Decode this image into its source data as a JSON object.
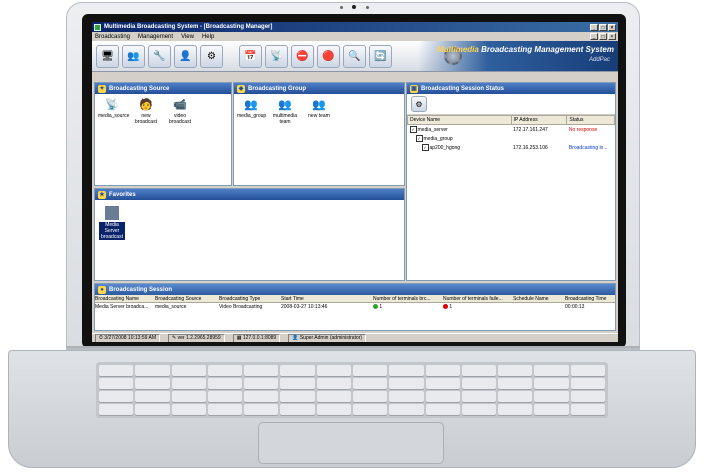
{
  "window": {
    "title": "Multimedia Broadcasting System - [Broadcasting Manager]"
  },
  "menu": [
    "Broadcasting",
    "Management",
    "View",
    "Help"
  ],
  "banner": {
    "prefix": "Multimedia",
    "title": "Broadcasting Management System",
    "subtitle": "AddPac"
  },
  "panels": {
    "source": {
      "title": "Broadcasting Source",
      "items": [
        "media_source",
        "new broadcast",
        "video broadcast"
      ]
    },
    "group": {
      "title": "Broadcasting Group",
      "items": [
        "media_group",
        "multimedia team",
        "new team"
      ]
    },
    "favorites": {
      "title": "Favorites",
      "item": "Media Server broadcast"
    },
    "status": {
      "title": "Broadcasting Session Status",
      "columns": [
        "Device Name",
        "IP Address",
        "Status"
      ],
      "rows": [
        {
          "name": "media_server",
          "ip": "172.17.161.247",
          "status": "No response"
        },
        {
          "name": "media_group",
          "ip": "",
          "status": ""
        },
        {
          "name": "ap200_hgong",
          "ip": "172.16.253.106",
          "status": "Broadcasting in..."
        }
      ]
    }
  },
  "session": {
    "title": "Broadcasting Session",
    "columns": [
      "Broadcasting Name",
      "Broadcasting Source",
      "Broadcasting Type",
      "Start Time",
      "Number of terminals brc...",
      "Number of terminals faile...",
      "Schedule Name",
      "Broadcasting Time"
    ],
    "row": [
      "Media Server broadca...",
      "media_source",
      "Video Broadcasting",
      "2008-03-27 10:13:46",
      "1",
      "1",
      "",
      "00:00:13"
    ]
  },
  "statusbar": {
    "time": "3/27/2008 10:13:59 AM",
    "version": "ver 1.2.2965.28959",
    "address": "127.0.0.1:8089",
    "user": "Super Admin (administrator)"
  },
  "colors": {
    "title_bar": "#0a246a",
    "panel_header": "#234f98",
    "error": "#dd0000",
    "active": "#0a3bd0"
  }
}
